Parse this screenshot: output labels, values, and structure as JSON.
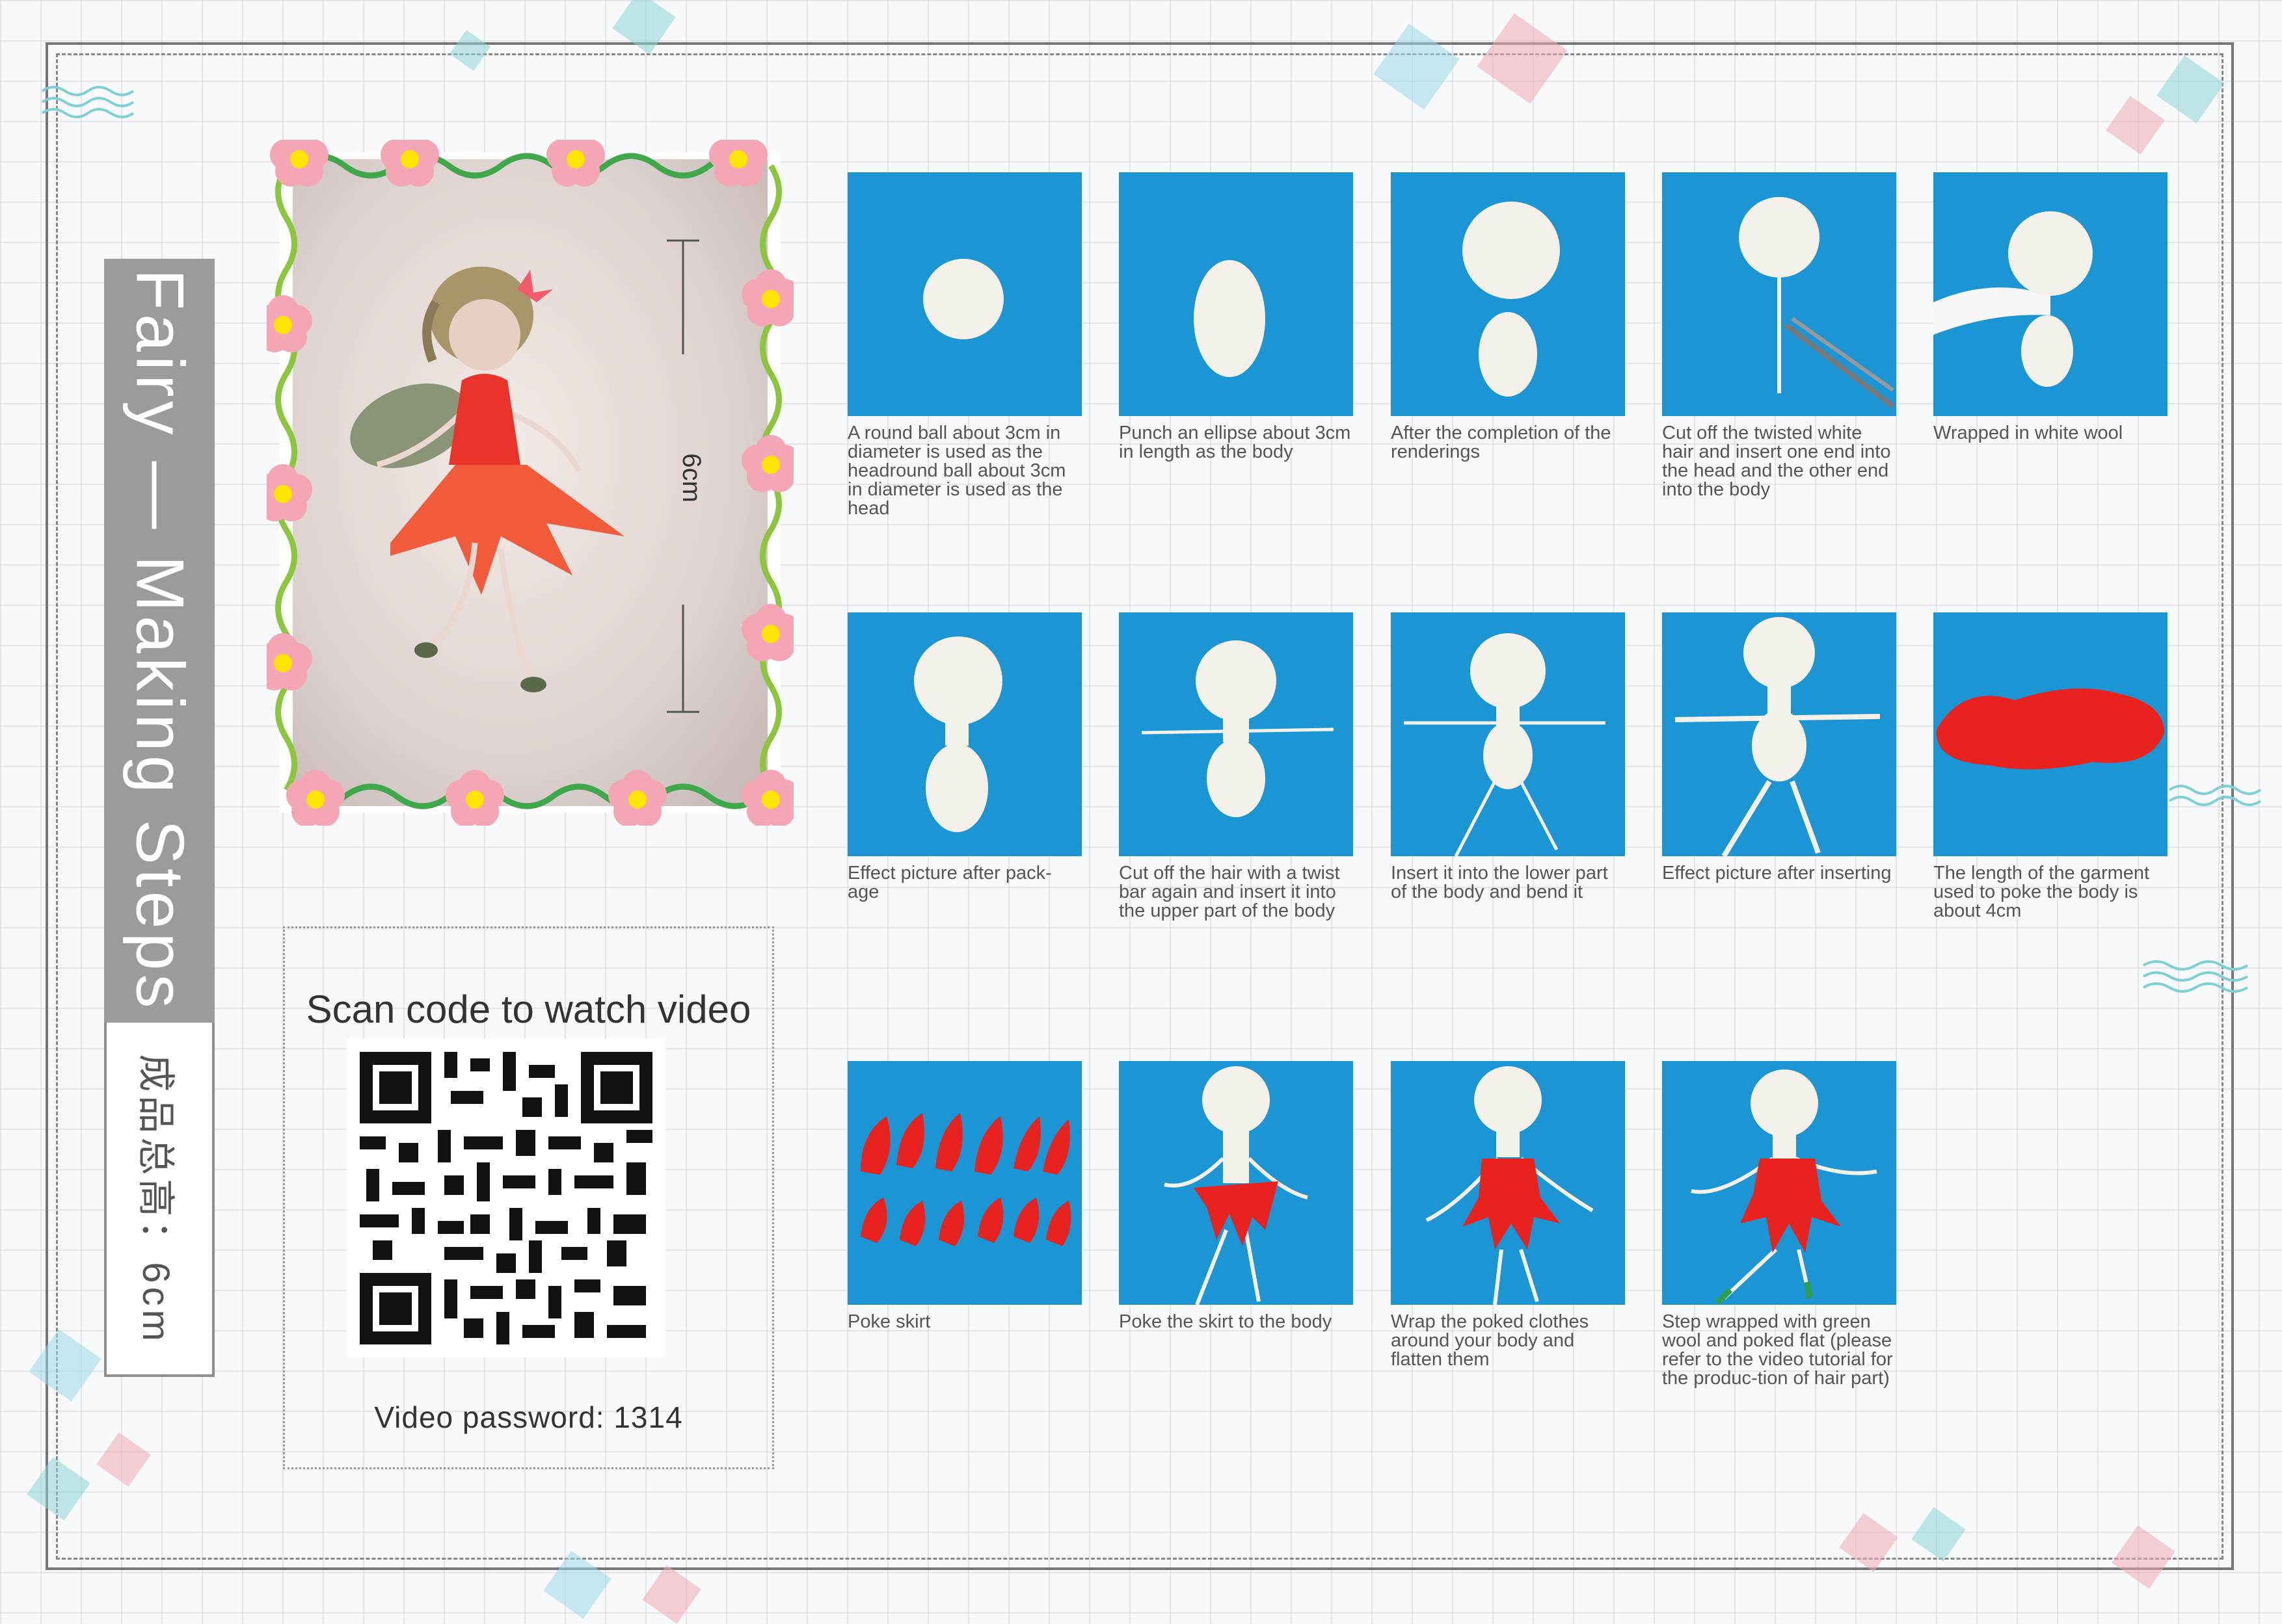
{
  "title": "Fairy — Making Steps",
  "subtitle": "成品总高：6cm",
  "hero": {
    "dimension_label": "6cm"
  },
  "qr": {
    "heading": "Scan code to watch video",
    "password_text": "Video  password:  1314"
  },
  "steps": [
    {
      "caption": "A round ball about 3cm in diameter is used as the headround ball about 3cm in diameter is used as the head"
    },
    {
      "caption": "Punch an ellipse about 3cm in length as the body"
    },
    {
      "caption": "After the completion of the renderings"
    },
    {
      "caption": "Cut off the twisted white hair and insert one end into the head and the other end into the body"
    },
    {
      "caption": "Wrapped in white wool"
    },
    {
      "caption": "Effect picture after pack-age"
    },
    {
      "caption": "Cut off the hair with a twist bar again and insert it into the upper part of the body"
    },
    {
      "caption": "Insert it into the lower part of the body and bend it"
    },
    {
      "caption": "Effect picture after inserting"
    },
    {
      "caption": "The length of the garment used to poke the body is about 4cm"
    },
    {
      "caption": "Poke skirt"
    },
    {
      "caption": "Poke the skirt to the body"
    },
    {
      "caption": "Wrap the poked clothes around your body and flatten them"
    },
    {
      "caption": "Step wrapped with green wool and poked flat (please refer to the video tutorial for the produc-tion of hair part)"
    }
  ],
  "colors": {
    "felt_blue": "#1c95d4",
    "wool_white": "#f4f1ea",
    "felt_red": "#e8221e",
    "title_gray": "#9b9b9b"
  }
}
